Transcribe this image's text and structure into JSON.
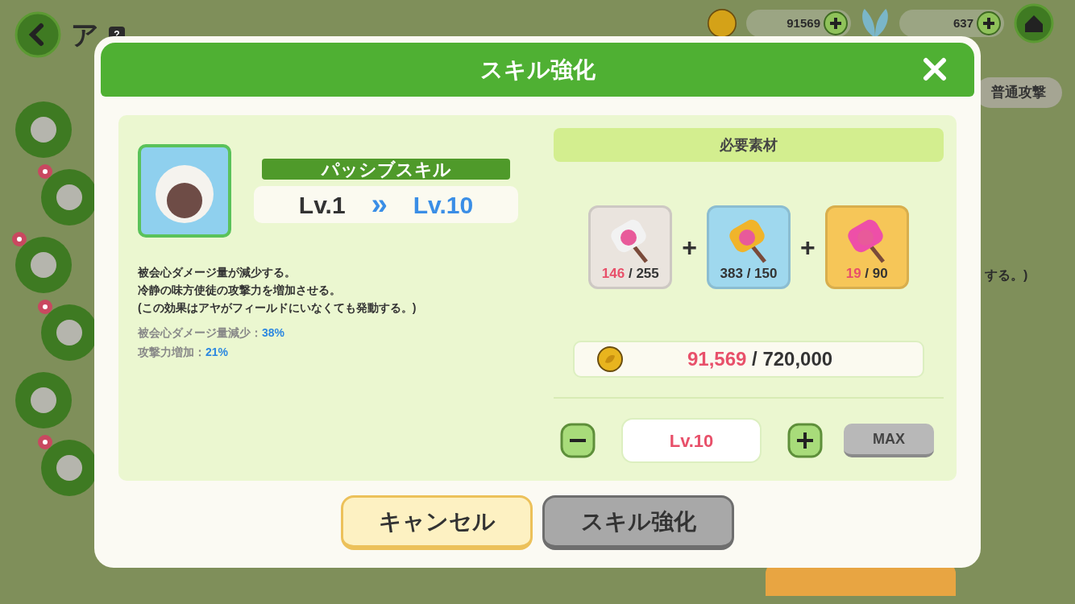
{
  "background": {
    "title": "ア",
    "help": "?",
    "currencies": [
      {
        "amount": "91569"
      },
      {
        "amount": "637"
      }
    ],
    "side_menu": [
      {
        "notification": false
      },
      {
        "notification": true
      },
      {
        "notification": true
      },
      {
        "notification": true
      },
      {
        "notification": false
      },
      {
        "notification": true
      }
    ],
    "attack_tab": "普通攻撃",
    "partial_text": "する。)"
  },
  "dialog": {
    "title": "スキル強化",
    "skill": {
      "type": "パッシブスキル",
      "level_from": "Lv.1",
      "arrow": "»",
      "level_to": "Lv.10",
      "description": [
        "被会心ダメージ量が減少する。",
        "冷静の味方使徒の攻撃力を増加させる。",
        "(この効果はアヤがフィールドにいなくても発動する。)"
      ],
      "stats": [
        {
          "label": "被会心ダメージ量減少：",
          "value": "38%"
        },
        {
          "label": "攻撃力増加：",
          "value": "21%"
        }
      ]
    },
    "materials": {
      "title": "必要素材",
      "separators": [
        "+",
        "+"
      ],
      "items": [
        {
          "have": "146",
          "need": "/ 255",
          "enough": false,
          "color": "#eae4de"
        },
        {
          "have": "383",
          "need": "/ 150",
          "enough": true,
          "color": "#9fd8ee"
        },
        {
          "have": "19",
          "need": "/ 90",
          "enough": false,
          "color": "#f6c658"
        }
      ],
      "cost": {
        "have": "91,569",
        "need": "/ 720,000",
        "enough": false
      }
    },
    "level_picker": {
      "value": "Lv.10",
      "max": "MAX"
    },
    "buttons": [
      {
        "label": "キャンセル",
        "kind": "cancel",
        "disabled": false
      },
      {
        "label": "スキル強化",
        "kind": "confirm",
        "disabled": true
      }
    ]
  }
}
